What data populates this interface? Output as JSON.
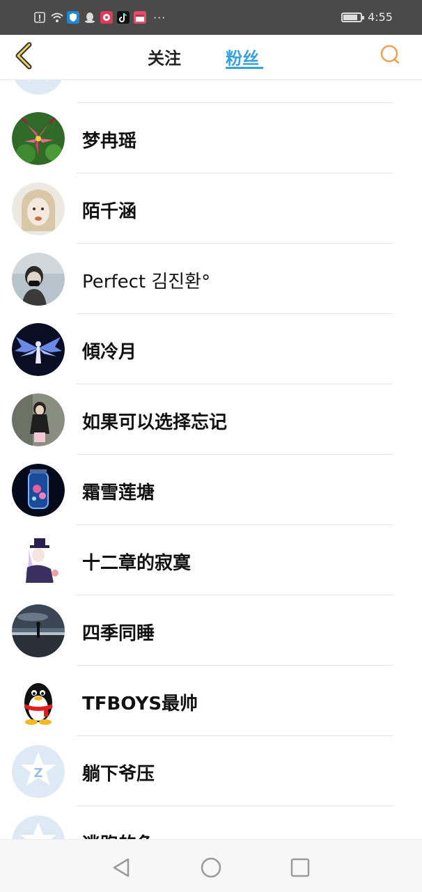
{
  "status_bar": {
    "time": "4:55",
    "more": "···",
    "icons": [
      "alert-icon",
      "wifi-icon",
      "shield-app-icon",
      "qq-app-icon",
      "music-app-icon",
      "tiktok-app-icon",
      "calendar-app-icon"
    ],
    "battery_level": 0.85
  },
  "header": {
    "tabs": [
      {
        "label": "关注",
        "active": false
      },
      {
        "label": "粉丝",
        "active": true
      }
    ],
    "accent": "#3aa0dc",
    "back_icon": "chevron-left-icon",
    "search_icon": "search-icon"
  },
  "fans": [
    {
      "name": "",
      "avatar": "default-avatar"
    },
    {
      "name": "梦冉瑶",
      "avatar": "lily-flower-avatar"
    },
    {
      "name": "陌千涵",
      "avatar": "anime-girl-avatar"
    },
    {
      "name": "Perfect 김진환°",
      "avatar": "masked-boy-avatar"
    },
    {
      "name": "傾冷月",
      "avatar": "winged-angel-avatar"
    },
    {
      "name": "如果可以选择忘记",
      "avatar": "girl-photo-avatar"
    },
    {
      "name": "霜雪莲塘",
      "avatar": "jar-scene-avatar"
    },
    {
      "name": "十二章的寂寞",
      "avatar": "anime-hat-avatar"
    },
    {
      "name": "四季同睡",
      "avatar": "sunset-sea-avatar"
    },
    {
      "name": "TFBOYS最帅",
      "avatar": "qq-penguin-avatar"
    },
    {
      "name": "躺下爷压",
      "avatar": "default-avatar"
    },
    {
      "name": "逃跑的鱼",
      "avatar": "default-avatar"
    }
  ],
  "nav": {
    "back": "back-triangle-icon",
    "home": "home-circle-icon",
    "recent": "recent-square-icon"
  }
}
